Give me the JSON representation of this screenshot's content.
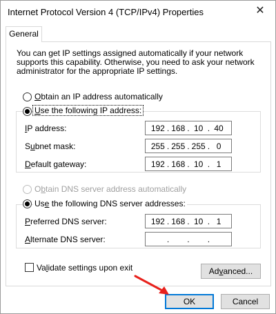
{
  "window": {
    "title": "Internet Protocol Version 4 (TCP/IPv4) Properties",
    "close_symbol": "✕"
  },
  "tabs": [
    {
      "label": "General",
      "selected": true
    }
  ],
  "intro_text": "You can get IP settings assigned automatically if your network supports this capability. Otherwise, you need to ask your network administrator for the appropriate IP settings.",
  "ip": {
    "auto_label": {
      "pre": "",
      "key": "O",
      "post": "btain an IP address automatically"
    },
    "manual_label": {
      "pre": "",
      "key": "U",
      "post": "se the following IP address:"
    },
    "selected": "manual",
    "fields": [
      {
        "label": {
          "pre": "",
          "key": "I",
          "post": "P address:"
        },
        "octets": [
          "192",
          "168",
          "10",
          "40"
        ]
      },
      {
        "label": {
          "pre": "S",
          "key": "u",
          "post": "bnet mask:"
        },
        "octets": [
          "255",
          "255",
          "255",
          "0"
        ]
      },
      {
        "label": {
          "pre": "",
          "key": "D",
          "post": "efault gateway:"
        },
        "octets": [
          "192",
          "168",
          "10",
          "1"
        ]
      }
    ]
  },
  "dns": {
    "auto_label": {
      "pre": "O",
      "key": "b",
      "post": "tain DNS server address automatically"
    },
    "manual_label": {
      "pre": "Us",
      "key": "e",
      "post": " the following DNS server addresses:"
    },
    "selected": "manual",
    "auto_disabled": true,
    "fields": [
      {
        "label": {
          "pre": "",
          "key": "P",
          "post": "referred DNS server:"
        },
        "octets": [
          "192",
          "168",
          "10",
          "1"
        ]
      },
      {
        "label": {
          "pre": "",
          "key": "A",
          "post": "lternate DNS server:"
        },
        "octets": [
          "",
          "",
          "",
          ""
        ]
      }
    ]
  },
  "validate": {
    "label": {
      "pre": "Va",
      "key": "l",
      "post": "idate settings upon exit"
    },
    "checked": false
  },
  "buttons": {
    "advanced": {
      "pre": "Ad",
      "key": "v",
      "post": "anced..."
    },
    "ok": "OK",
    "cancel": "Cancel"
  },
  "annotation": {
    "arrow_color": "#e8211c"
  }
}
